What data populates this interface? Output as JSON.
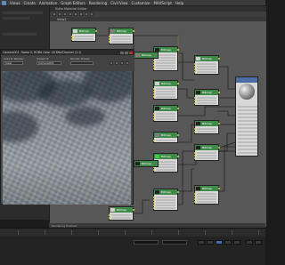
{
  "menubar": {
    "items": [
      "Views",
      "Create",
      "Animation",
      "Graph Editors",
      "Rendering",
      "Civil View",
      "Customize",
      "MAXScript",
      "Help"
    ]
  },
  "slate": {
    "title": "Slate Material Editor",
    "tab": "View1",
    "status": "Rendering finished"
  },
  "render_window": {
    "title": "Camera001, frame 0, RGBA Color 16 Bits/Channel (1:1)",
    "area_label": "Area to Render:",
    "area_value": "View",
    "viewport_label": "Viewport:",
    "viewport_value": "Camera001",
    "preset_label": "Render Preset:"
  },
  "nodes": [
    {
      "name": "Bitmap",
      "type": "map"
    },
    {
      "name": "Bitmap",
      "type": "map"
    },
    {
      "name": "Bitmap",
      "type": "map"
    },
    {
      "name": "Bitmap",
      "type": "map"
    },
    {
      "name": "Bitmap",
      "type": "map"
    },
    {
      "name": "Bitmap",
      "type": "map"
    },
    {
      "name": "Bitmap",
      "type": "map"
    },
    {
      "name": "Bitmap",
      "type": "map"
    },
    {
      "name": "Bitmap",
      "type": "map"
    },
    {
      "name": "Bitmap",
      "type": "map"
    },
    {
      "name": "Bitmap",
      "type": "map"
    },
    {
      "name": "Bitmap",
      "type": "map"
    },
    {
      "name": "Bitmap",
      "type": "map"
    },
    {
      "name": "Bitmap",
      "type": "map"
    },
    {
      "name": "Bitmap",
      "type": "map"
    },
    {
      "name": "Bitmap",
      "type": "map"
    }
  ],
  "material_node": {
    "name": "Material"
  },
  "colors": {
    "node_header": "#3f8a4a",
    "material_header": "#4c6ea6",
    "socket": "#e0d84a"
  }
}
